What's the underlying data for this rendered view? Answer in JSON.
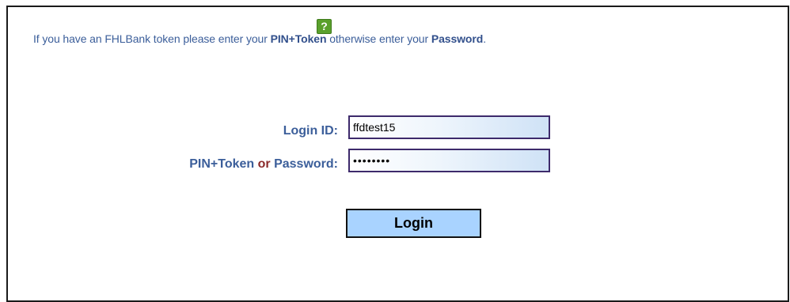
{
  "intro": {
    "text_before": "If you have an FHLBank token please enter your ",
    "pin_token": "PIN+Token",
    "text_middle": " otherwise enter your ",
    "password": "Password",
    "text_end": ".",
    "help_icon_glyph": "?",
    "help_icon_name": "help-icon",
    "help_icon_color": "#5aa02c"
  },
  "form": {
    "login_id_label": "Login ID:",
    "login_id_value": "ffdtest15",
    "pin_label_part1": "PIN+Token",
    "pin_label_or": "or",
    "pin_label_part2": "Password:",
    "password_value": "password",
    "login_button_label": "Login"
  },
  "colors": {
    "label_blue": "#3b5e9a",
    "or_red": "#8b2a2a",
    "button_fill": "#a9d3ff",
    "field_border": "#3d2a6b"
  }
}
